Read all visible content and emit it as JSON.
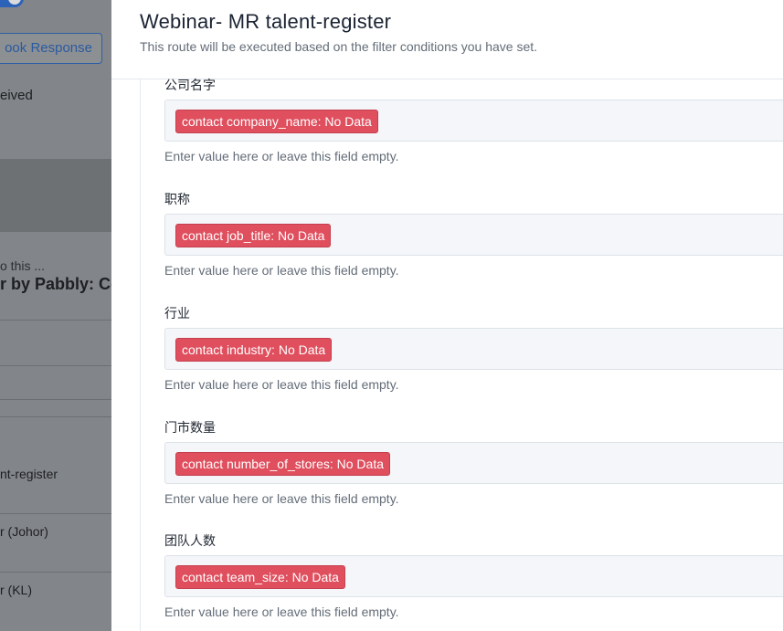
{
  "background": {
    "response_button": "ook Response",
    "received_text": "eived",
    "do_this_text": "o this ...",
    "app_name": "r by Pabbly: Co",
    "routes": [
      "nt-register",
      "r (Johor)",
      "r (KL)"
    ]
  },
  "modal": {
    "title": "Webinar- MR talent-register",
    "subtitle": "This route will be executed based on the filter conditions you have set.",
    "fields": [
      {
        "label": "公司名字",
        "value": "contact company_name: No Data",
        "help": "Enter value here or leave this field empty."
      },
      {
        "label": "职称",
        "value": "contact job_title: No Data",
        "help": "Enter value here or leave this field empty."
      },
      {
        "label": "行业",
        "value": "contact industry: No Data",
        "help": "Enter value here or leave this field empty."
      },
      {
        "label": "门市数量",
        "value": "contact number_of_stores: No Data",
        "help": "Enter value here or leave this field empty."
      },
      {
        "label": "团队人数",
        "value": "contact team_size: No Data",
        "help": "Enter value here or leave this field empty."
      }
    ]
  },
  "colors": {
    "pill": "#df4f5e",
    "overlay": "#828589",
    "accent": "#2c63b8"
  }
}
